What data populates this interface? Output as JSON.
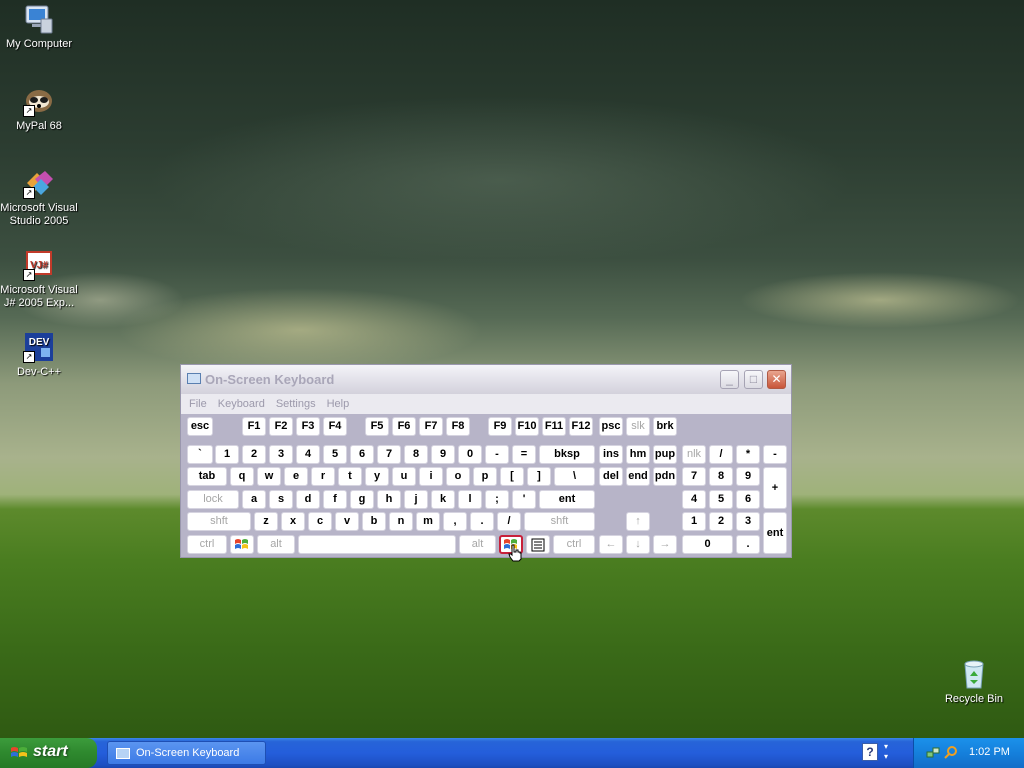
{
  "desktop": {
    "icons": [
      {
        "label": "My Computer",
        "icon": "computer-icon"
      },
      {
        "label": "MyPal 68",
        "icon": "mypal-icon"
      },
      {
        "label": "Microsoft Visual Studio 2005",
        "icon": "visual-studio-icon"
      },
      {
        "label": "Microsoft Visual J# 2005 Exp...",
        "icon": "visual-jsharp-icon"
      },
      {
        "label": "Dev-C++",
        "icon": "devcpp-icon"
      },
      {
        "label": "Recycle Bin",
        "icon": "recycle-bin-icon"
      }
    ],
    "devcpp_badge": "DEV",
    "vj_badge": "VJ#"
  },
  "osk": {
    "title": "On-Screen Keyboard",
    "title_buttons": {
      "minimize": "_",
      "maximize": "□",
      "close": "✕"
    },
    "menu": [
      "File",
      "Keyboard",
      "Settings",
      "Help"
    ],
    "rows": {
      "fn": [
        "esc",
        "F1",
        "F2",
        "F3",
        "F4",
        "F5",
        "F6",
        "F7",
        "F8",
        "F9",
        "F10",
        "F11",
        "F12",
        "psc",
        "slk",
        "brk"
      ],
      "num": [
        "`",
        "1",
        "2",
        "3",
        "4",
        "5",
        "6",
        "7",
        "8",
        "9",
        "0",
        "-",
        "=",
        "bksp",
        "ins",
        "hm",
        "pup",
        "nlk",
        "/",
        "*",
        "-"
      ],
      "tab": [
        "tab",
        "q",
        "w",
        "e",
        "r",
        "t",
        "y",
        "u",
        "i",
        "o",
        "p",
        "[",
        "]",
        "\\",
        "del",
        "end",
        "pdn",
        "7",
        "8",
        "9",
        "+"
      ],
      "home": [
        "lock",
        "a",
        "s",
        "d",
        "f",
        "g",
        "h",
        "j",
        "k",
        "l",
        ";",
        "'",
        "ent",
        "4",
        "5",
        "6"
      ],
      "shift": [
        "shft",
        "z",
        "x",
        "c",
        "v",
        "b",
        "n",
        "m",
        ",",
        ".",
        "/",
        "shft",
        "↑",
        "1",
        "2",
        "3",
        "ent"
      ],
      "bottom": [
        "ctrl",
        "alt",
        "alt",
        "ctrl",
        "←",
        "↓",
        "→",
        "0",
        "."
      ]
    },
    "special_keys": {
      "win": "windows-logo-icon",
      "app": "app-menu-icon"
    }
  },
  "taskbar": {
    "start_label": "start",
    "task_label": "On-Screen Keyboard",
    "lang_indicator": "?",
    "clock": "1:02 PM"
  },
  "colors": {
    "taskbar_blue": "#245edb",
    "start_green": "#2f8a2f",
    "osk_body": "#b7b4c8",
    "tray_blue": "#1580dc"
  }
}
